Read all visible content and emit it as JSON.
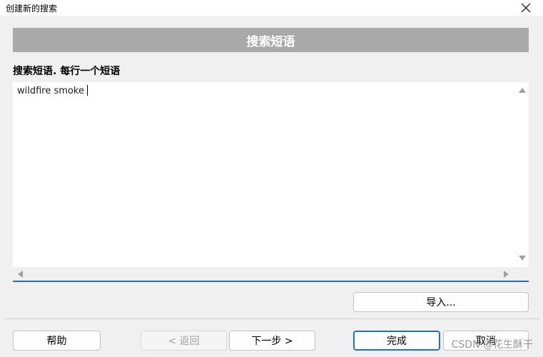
{
  "window": {
    "title": "创建新的搜索",
    "close_icon": "close-icon"
  },
  "banner": {
    "title": "搜索短语"
  },
  "instruction": "搜索短语. 每行一个短语",
  "editor": {
    "value": "wildfire smoke"
  },
  "buttons": {
    "import": "导入...",
    "help": "帮助",
    "back": "< 返回",
    "next": "下一步 >",
    "finish": "完成",
    "cancel": "取消"
  },
  "watermark": "CSDN @花生酥干",
  "colors": {
    "banner_bg": "#a9a9a9",
    "accent": "#1e6fd2",
    "dialog_bg": "#f0f0f0"
  }
}
